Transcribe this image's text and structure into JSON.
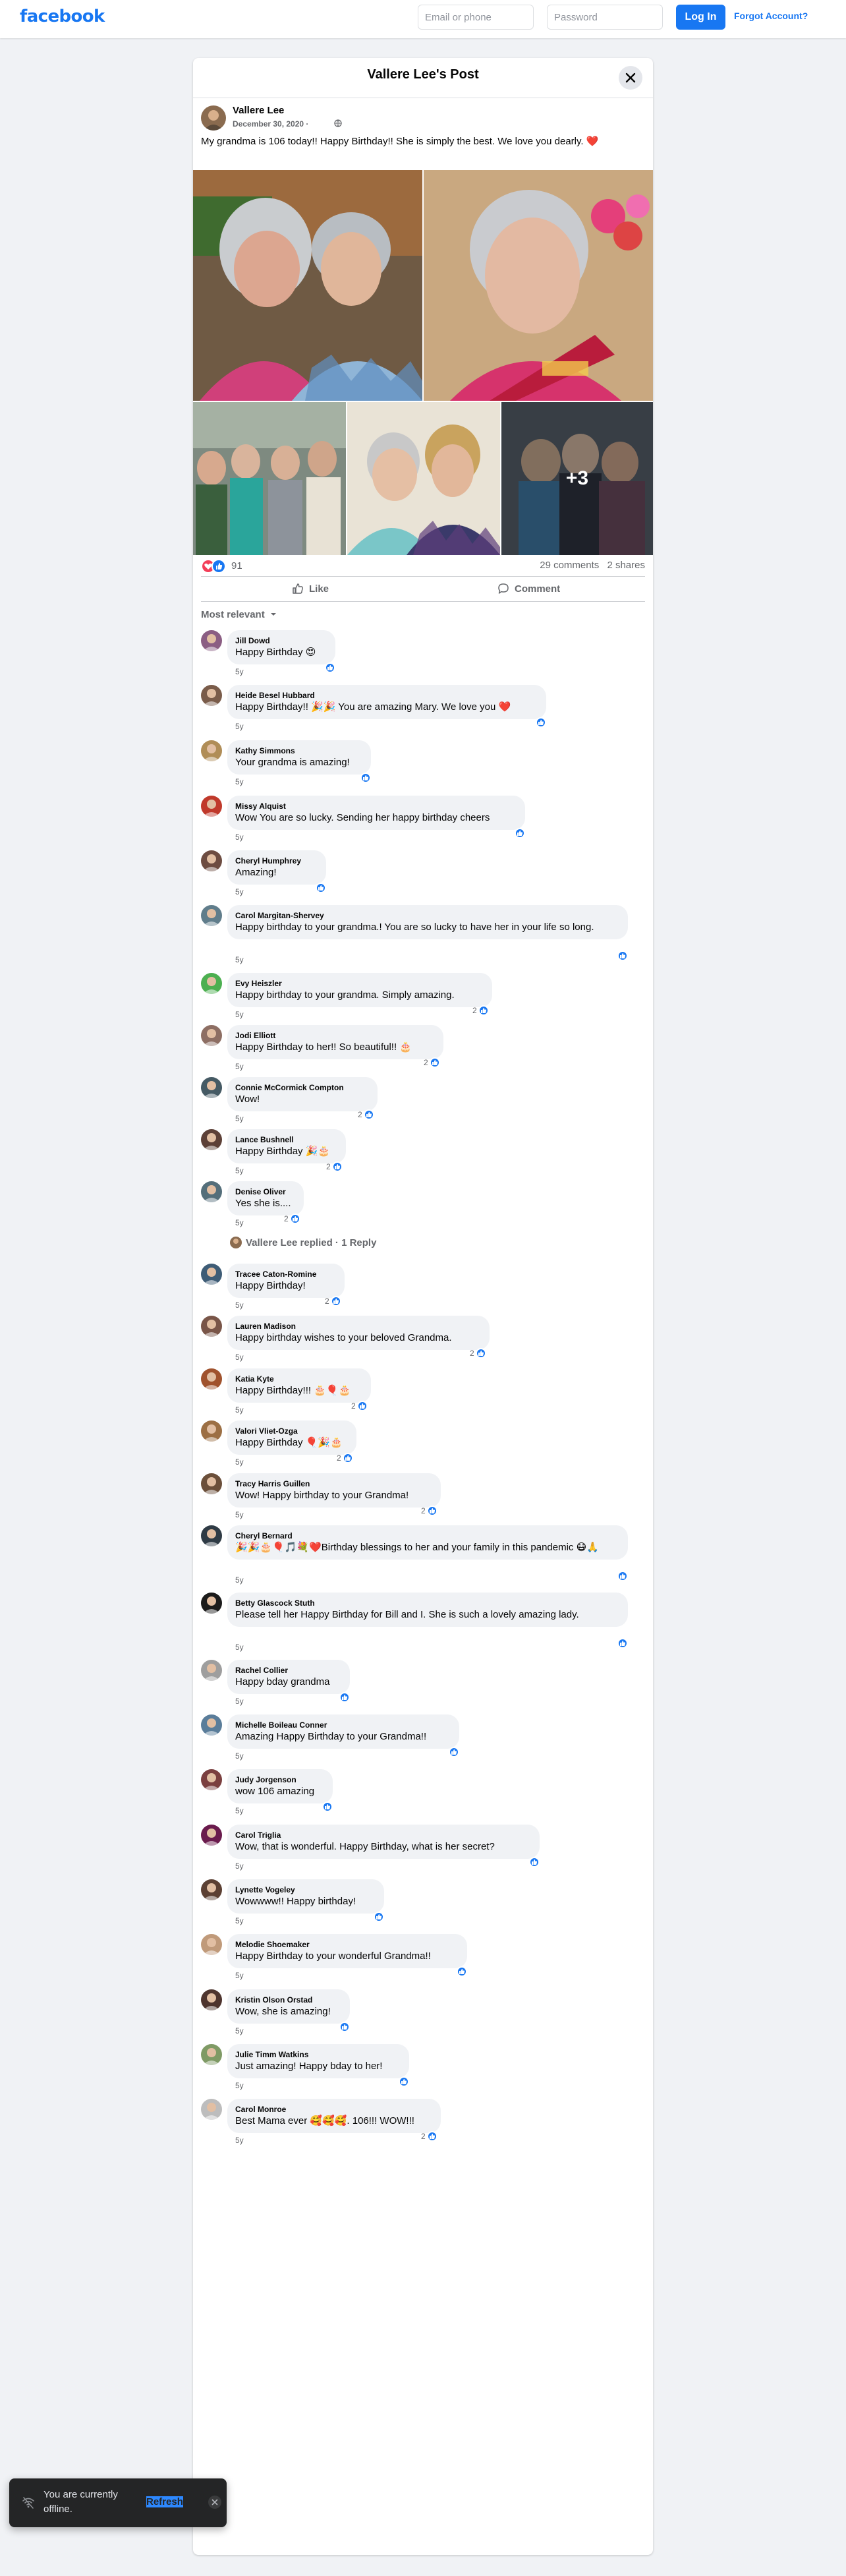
{
  "header": {
    "logo": "facebook",
    "email_placeholder": "Email or phone",
    "password_placeholder": "Password",
    "login_label": "Log In",
    "forgot_label": "Forgot Account?"
  },
  "post": {
    "dialog_title": "Vallere Lee's Post",
    "author": "Vallere Lee",
    "date": "December 30, 2020 ·",
    "text": "My grandma is 106 today!! Happy Birthday!! She is simply the best. We love you dearly.",
    "text_emoji": "❤️",
    "more_photos_label": "+3",
    "reaction_count": "91",
    "comments_label": "29 comments",
    "shares_label": "2 shares",
    "like_label": "Like",
    "comment_label": "Comment",
    "sort_label": "Most relevant"
  },
  "comments": [
    {
      "name": "Jill Dowd",
      "text": "Happy Birthday 😍",
      "time": "5y",
      "likes": ""
    },
    {
      "name": "Heide Besel Hubbard",
      "text": "Happy Birthday!! 🎉🎉 You are amazing Mary. We love you ❤️",
      "time": "5y",
      "likes": ""
    },
    {
      "name": "Kathy Simmons",
      "text": "Your grandma is amazing!",
      "time": "5y",
      "likes": ""
    },
    {
      "name": "Missy Alquist",
      "text": "Wow You are so lucky. Sending her happy birthday cheers",
      "time": "5y",
      "likes": ""
    },
    {
      "name": "Cheryl Humphrey",
      "text": "Amazing!",
      "time": "5y",
      "likes": ""
    },
    {
      "name": "Carol Margitan-Shervey",
      "text": "Happy birthday to your grandma.! You are so lucky to have her in your life so long.",
      "time": "5y",
      "likes": ""
    },
    {
      "name": "Evy Heiszler",
      "text": "Happy birthday to your grandma. Simply amazing.",
      "time": "5y",
      "likes": "2"
    },
    {
      "name": "Jodi Elliott",
      "text": "Happy Birthday to her!! So beautiful!! 🎂",
      "time": "5y",
      "likes": "2"
    },
    {
      "name": "Connie McCormick Compton",
      "text": "Wow!",
      "time": "5y",
      "likes": "2"
    },
    {
      "name": "Lance Bushnell",
      "text": "Happy Birthday 🎉🎂",
      "time": "5y",
      "likes": "2"
    },
    {
      "name": "Denise Oliver",
      "text": "Yes she is....",
      "time": "5y",
      "likes": "2"
    },
    {
      "name": "Tracee Caton-Romine",
      "text": "Happy Birthday!",
      "time": "5y",
      "likes": "2"
    },
    {
      "name": "Lauren Madison",
      "text": "Happy birthday wishes to your beloved Grandma.",
      "time": "5y",
      "likes": "2"
    },
    {
      "name": "Katia Kyte",
      "text": "Happy Birthday!!! 🎂🎈🎂",
      "time": "5y",
      "likes": "2"
    },
    {
      "name": "Valori Vliet-Ozga",
      "text": "Happy Birthday 🎈🎉🎂",
      "time": "5y",
      "likes": "2"
    },
    {
      "name": "Tracy Harris Guillen",
      "text": "Wow! Happy birthday to your Grandma!",
      "time": "5y",
      "likes": "2"
    },
    {
      "name": "Cheryl Bernard",
      "text": "🎉🎉🎂🎈🎵💐❤️Birthday blessings to her and your family in this pandemic 😷🙏",
      "time": "5y",
      "likes": ""
    },
    {
      "name": "Betty Glascock Stuth",
      "text": "Please tell her Happy Birthday for Bill and I. She is such a lovely amazing lady.",
      "time": "5y",
      "likes": ""
    },
    {
      "name": "Rachel Collier",
      "text": "Happy bday grandma",
      "time": "5y",
      "likes": ""
    },
    {
      "name": "Michelle Boileau Conner",
      "text": "Amazing Happy Birthday to your Grandma!!",
      "time": "5y",
      "likes": ""
    },
    {
      "name": "Judy Jorgenson",
      "text": "wow 106 amazing",
      "time": "5y",
      "likes": ""
    },
    {
      "name": "Carol Triglia",
      "text": "Wow, that is wonderful. Happy Birthday, what is her secret?",
      "time": "5y",
      "likes": ""
    },
    {
      "name": "Lynette Vogeley",
      "text": "Wowwww!! Happy birthday!",
      "time": "5y",
      "likes": ""
    },
    {
      "name": "Melodie Shoemaker",
      "text": "Happy Birthday to your wonderful Grandma!!",
      "time": "5y",
      "likes": ""
    },
    {
      "name": "Kristin Olson Orstad",
      "text": "Wow, she is amazing!",
      "time": "5y",
      "likes": ""
    },
    {
      "name": "Julie Timm Watkins",
      "text": "Just amazing! Happy bday to her!",
      "time": "5y",
      "likes": ""
    },
    {
      "name": "Carol Monroe",
      "text": "Best Mama ever 🥰🥰🥰. 106!!! WOW!!!",
      "time": "5y",
      "likes": "2"
    }
  ],
  "replies_link": "Vallere Lee replied · 1 Reply",
  "toast": {
    "message": "You are currently offline.",
    "refresh_label": "Refresh"
  },
  "colors": {
    "brand": "#1877f2",
    "page_bg": "#f0f2f5",
    "bubble_bg": "#f0f2f5",
    "secondary_text": "#65676b",
    "love": "#f02849"
  }
}
